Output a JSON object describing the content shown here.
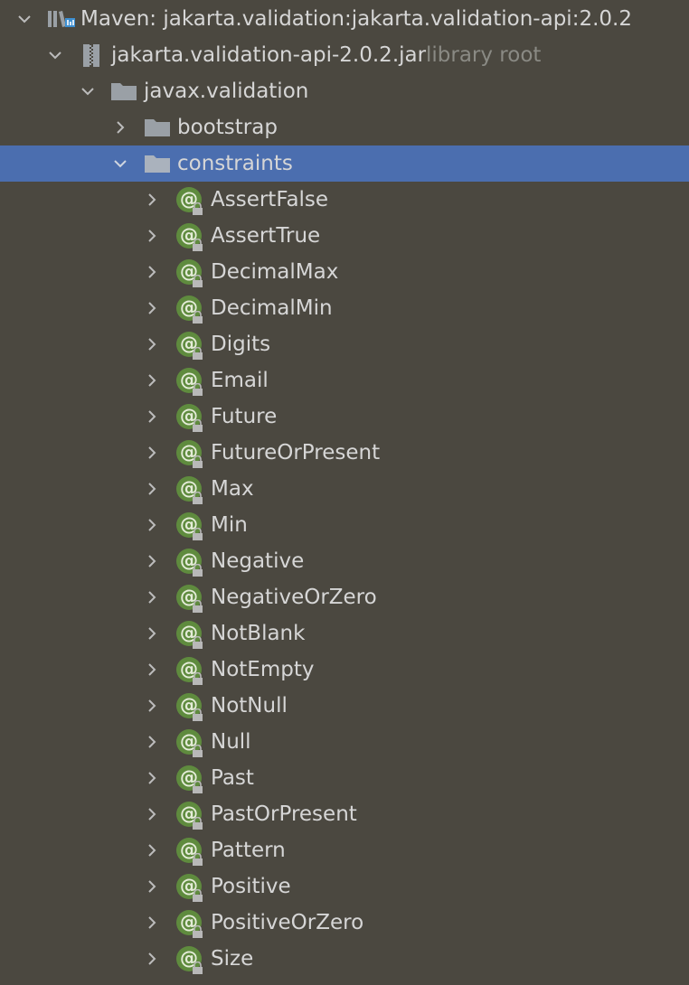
{
  "colors": {
    "background": "#4b4840",
    "selection": "#4b6eaf",
    "text": "#d6d6d6",
    "secondary_text": "#8a8a84",
    "annotation_green": "#5f8b3e"
  },
  "tree": {
    "maven_library": {
      "label": "Maven: jakarta.validation:jakarta.validation-api:2.0.2",
      "expanded": true,
      "icon": "maven-library-icon"
    },
    "jar": {
      "label": "jakarta.validation-api-2.0.2.jar",
      "secondary": "library root",
      "expanded": true,
      "icon": "jar-archive-icon"
    },
    "package_root": {
      "label": "javax.validation",
      "expanded": true,
      "icon": "package-folder-icon"
    },
    "bootstrap": {
      "label": "bootstrap",
      "expanded": false,
      "icon": "package-folder-icon"
    },
    "constraints": {
      "label": "constraints",
      "expanded": true,
      "selected": true,
      "icon": "package-folder-icon"
    },
    "annotations": [
      "AssertFalse",
      "AssertTrue",
      "DecimalMax",
      "DecimalMin",
      "Digits",
      "Email",
      "Future",
      "FutureOrPresent",
      "Max",
      "Min",
      "Negative",
      "NegativeOrZero",
      "NotBlank",
      "NotEmpty",
      "NotNull",
      "Null",
      "Past",
      "PastOrPresent",
      "Pattern",
      "Positive",
      "PositiveOrZero",
      "Size"
    ],
    "annotation_glyph": "@"
  }
}
